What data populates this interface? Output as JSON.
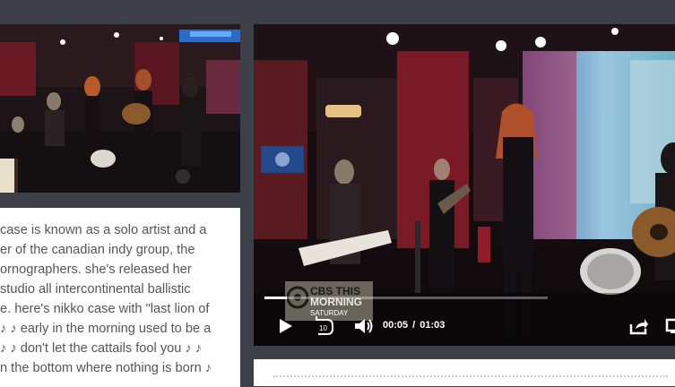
{
  "transcript": {
    "lines": [
      "case is known as a solo artist and a",
      "er of the canadian indy group, the",
      "ornographers. she's released her",
      "studio all intercontinental ballistic",
      "e. here's nikko case with \"last lion of",
      "♪ ♪ early in the morning used to be a",
      " ♪ ♪ don't let the cattails fool you ♪ ♪",
      "n the bottom where nothing is born ♪"
    ]
  },
  "player": {
    "logo": {
      "line1": "CBS THIS",
      "line2": "MORNING",
      "line3": "SATURDAY"
    },
    "progress": 0.08,
    "current_time": "00:05",
    "time_separator": "/",
    "duration": "01:03",
    "icons": {
      "play": "play-icon",
      "replay": "replay-10-icon",
      "replay_label": "10",
      "volume": "volume-icon",
      "share": "share-icon",
      "fullscreen": "fullscreen-icon"
    }
  },
  "colors": {
    "page_background": "#3d4049",
    "card_background": "#ffffff",
    "transcript_text": "#555555",
    "controls": "#ffffff"
  }
}
